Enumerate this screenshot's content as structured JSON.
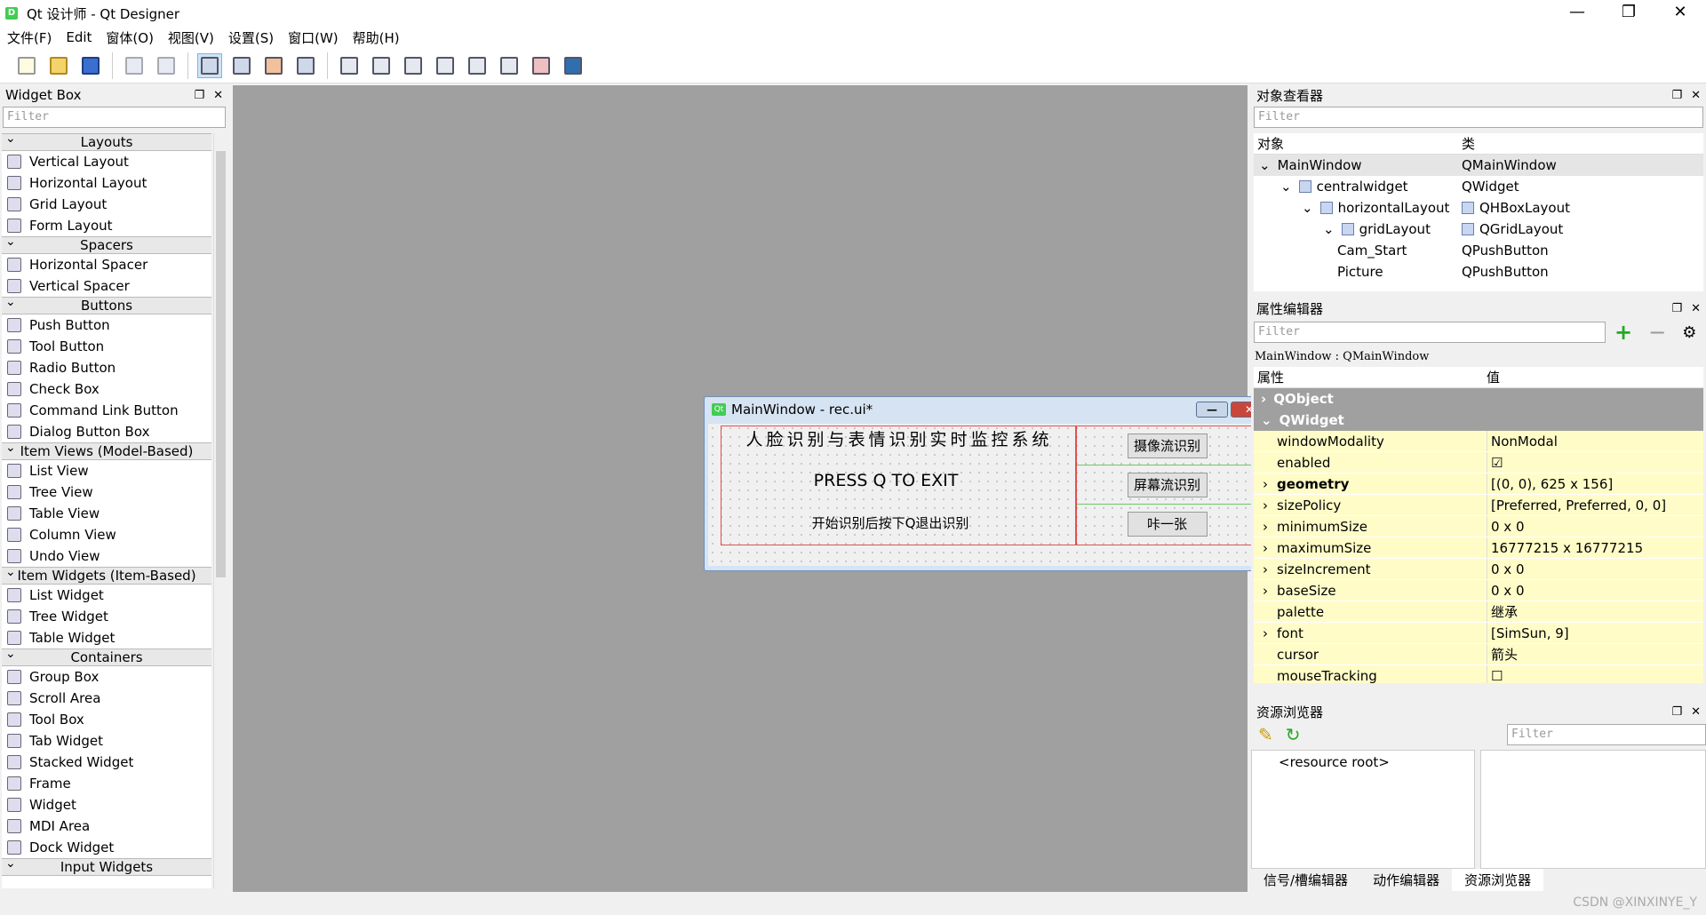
{
  "window": {
    "title": "Qt 设计师 - Qt Designer",
    "app_icon": "D"
  },
  "menu": [
    "文件(F)",
    "Edit",
    "窗体(O)",
    "视图(V)",
    "设置(S)",
    "窗口(W)",
    "帮助(H)"
  ],
  "widget_box": {
    "title": "Widget Box",
    "filter_placeholder": "Filter",
    "sections": [
      {
        "name": "Layouts",
        "items": [
          "Vertical Layout",
          "Horizontal Layout",
          "Grid Layout",
          "Form Layout"
        ]
      },
      {
        "name": "Spacers",
        "items": [
          "Horizontal Spacer",
          "Vertical Spacer"
        ]
      },
      {
        "name": "Buttons",
        "items": [
          "Push Button",
          "Tool Button",
          "Radio Button",
          "Check Box",
          "Command Link Button",
          "Dialog Button Box"
        ]
      },
      {
        "name": "Item Views (Model-Based)",
        "items": [
          "List View",
          "Tree View",
          "Table View",
          "Column View",
          "Undo View"
        ]
      },
      {
        "name": "Item Widgets (Item-Based)",
        "items": [
          "List Widget",
          "Tree Widget",
          "Table Widget"
        ]
      },
      {
        "name": "Containers",
        "items": [
          "Group Box",
          "Scroll Area",
          "Tool Box",
          "Tab Widget",
          "Stacked Widget",
          "Frame",
          "Widget",
          "MDI Area",
          "Dock Widget"
        ]
      },
      {
        "name": "Input Widgets",
        "items": []
      }
    ]
  },
  "form": {
    "title": "MainWindow - rec.ui*",
    "label_title": "人脸识别与表情识别实时监控系统",
    "label_exit": "PRESS Q TO EXIT",
    "label_hint": "开始识别后按下Q退出识别",
    "buttons": [
      "摄像流识别",
      "屏幕流识别",
      "咔一张"
    ]
  },
  "object_inspector": {
    "title": "对象查看器",
    "filter_placeholder": "Filter",
    "col_object": "对象",
    "col_class": "类",
    "rows": [
      {
        "name": "MainWindow",
        "cls": "QMainWindow",
        "level": 0
      },
      {
        "name": "centralwidget",
        "cls": "QWidget",
        "level": 1
      },
      {
        "name": "horizontalLayout",
        "cls": "QHBoxLayout",
        "level": 2
      },
      {
        "name": "gridLayout",
        "cls": "QGridLayout",
        "level": 3
      },
      {
        "name": "Cam_Start",
        "cls": "QPushButton",
        "level": 4
      },
      {
        "name": "Picture",
        "cls": "QPushButton",
        "level": 4
      }
    ]
  },
  "property_editor": {
    "title": "属性编辑器",
    "filter_placeholder": "Filter",
    "context": "MainWindow : QMainWindow",
    "col_prop": "属性",
    "col_value": "值",
    "group1": "QObject",
    "group2": "QWidget",
    "props": [
      {
        "name": "windowModality",
        "value": "NonModal"
      },
      {
        "name": "enabled",
        "value": "☑"
      },
      {
        "name": "geometry",
        "value": "[(0, 0), 625 x 156]"
      },
      {
        "name": "sizePolicy",
        "value": "[Preferred, Preferred, 0, 0]"
      },
      {
        "name": "minimumSize",
        "value": "0 x 0"
      },
      {
        "name": "maximumSize",
        "value": "16777215 x 16777215"
      },
      {
        "name": "sizeIncrement",
        "value": "0 x 0"
      },
      {
        "name": "baseSize",
        "value": "0 x 0"
      },
      {
        "name": "palette",
        "value": "继承"
      },
      {
        "name": "font",
        "value": "[SimSun, 9]"
      },
      {
        "name": "cursor",
        "value": "箭头"
      },
      {
        "name": "mouseTracking",
        "value": "☐"
      }
    ]
  },
  "resource_browser": {
    "title": "资源浏览器",
    "filter_placeholder": "Filter",
    "root": "<resource root>",
    "tabs": [
      "信号/槽编辑器",
      "动作编辑器",
      "资源浏览器"
    ]
  },
  "watermark": "CSDN @XINXINYE_Y"
}
